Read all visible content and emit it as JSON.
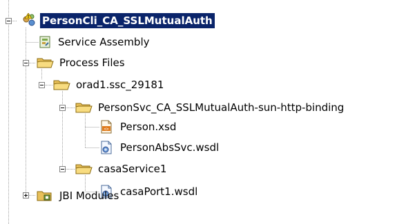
{
  "tree": {
    "root": {
      "label": "PersonCli_CA_SSLMutualAuth",
      "icon": "composite-app-warning-icon"
    },
    "service_assembly": {
      "label": "Service Assembly",
      "icon": "service-assembly-icon"
    },
    "process_files": {
      "label": "Process Files",
      "icon": "folder-open-icon"
    },
    "orad1": {
      "label": "orad1.ssc_29181",
      "icon": "folder-open-icon"
    },
    "binding_folder": {
      "label": "PersonSvc_CA_SSLMutualAuth-sun-http-binding",
      "icon": "folder-open-icon"
    },
    "person_xsd": {
      "label": "Person.xsd",
      "icon": "xsd-file-icon"
    },
    "person_wsdl": {
      "label": "PersonAbsSvc.wsdl",
      "icon": "wsdl-file-icon"
    },
    "casa_folder": {
      "label": "casaService1",
      "icon": "folder-open-icon"
    },
    "casa_wsdl": {
      "label": "casaPort1.wsdl",
      "icon": "wsdl-file-icon"
    },
    "jbi_modules": {
      "label": "JBI Modules",
      "icon": "jbi-modules-folder-icon"
    }
  },
  "colors": {
    "selection": "#0a246a",
    "tree_lines": "#a0a0a0",
    "folder": "#f4d26a"
  }
}
